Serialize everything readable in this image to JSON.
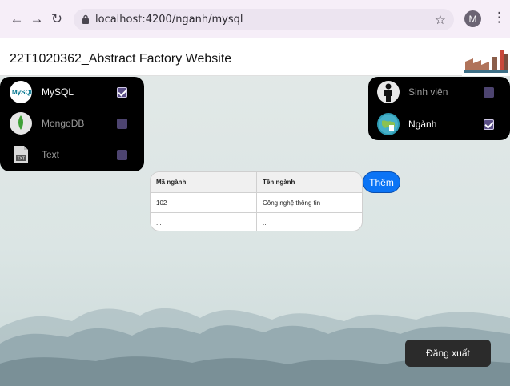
{
  "browser": {
    "url": "localhost:4200/nganh/mysql",
    "profile_initial": "M"
  },
  "header": {
    "title": "22T1020362_Abstract Factory Website"
  },
  "db_options": [
    {
      "label": "MySQL",
      "checked": true,
      "icon": "mysql-icon"
    },
    {
      "label": "MongoDB",
      "checked": false,
      "icon": "mongodb-icon"
    },
    {
      "label": "Text",
      "checked": false,
      "icon": "text-file-icon"
    }
  ],
  "entity_options": [
    {
      "label": "Sinh viên",
      "checked": false,
      "icon": "person-icon"
    },
    {
      "label": "Ngành",
      "checked": true,
      "icon": "globe-icon"
    }
  ],
  "table": {
    "columns": [
      "Mã ngành",
      "Tên ngành"
    ],
    "rows": [
      [
        "102",
        "Công nghệ thông tin"
      ],
      [
        "...",
        "..."
      ]
    ]
  },
  "actions": {
    "add_label": "Thêm",
    "logout_label": "Đăng xuất"
  },
  "colors": {
    "add_button": "#0b74f5",
    "panel": "#000000",
    "checkbox": "#4d4470"
  }
}
